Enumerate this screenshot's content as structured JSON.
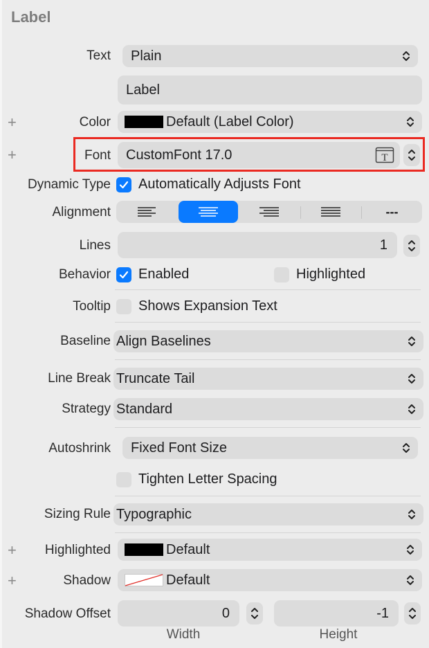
{
  "section_title": "Label",
  "text": {
    "label": "Text",
    "value": "Plain"
  },
  "label_text": {
    "value": "Label"
  },
  "color": {
    "label": "Color",
    "value": "Default (Label Color)",
    "swatch": "#000000"
  },
  "font": {
    "label": "Font",
    "value": "CustomFont 17.0",
    "highlight_color": "#ea2a22"
  },
  "dynamic_type": {
    "label": "Dynamic Type",
    "checkbox_label": "Automatically Adjusts Font",
    "checked": true
  },
  "alignment": {
    "label": "Alignment",
    "options": [
      "left",
      "center",
      "right",
      "justified",
      "natural"
    ],
    "selected": "center",
    "natural_glyph": "---"
  },
  "lines": {
    "label": "Lines",
    "value": "1"
  },
  "behavior": {
    "label": "Behavior",
    "enabled": {
      "label": "Enabled",
      "checked": true
    },
    "highlighted": {
      "label": "Highlighted",
      "checked": false
    }
  },
  "tooltip": {
    "label": "Tooltip",
    "checkbox_label": "Shows Expansion Text",
    "checked": false
  },
  "baseline": {
    "label": "Baseline",
    "value": "Align Baselines"
  },
  "line_break": {
    "label": "Line Break",
    "value": "Truncate Tail"
  },
  "strategy": {
    "label": "Strategy",
    "value": "Standard"
  },
  "autoshrink": {
    "label": "Autoshrink",
    "value": "Fixed Font Size"
  },
  "tighten": {
    "label": "Tighten Letter Spacing",
    "checked": false
  },
  "sizing_rule": {
    "label": "Sizing Rule",
    "value": "Typographic"
  },
  "highlighted_color": {
    "label": "Highlighted",
    "value": "Default",
    "swatch": "#000000"
  },
  "shadow": {
    "label": "Shadow",
    "value": "Default"
  },
  "shadow_offset": {
    "label": "Shadow Offset",
    "width": {
      "value": "0",
      "caption": "Width"
    },
    "height": {
      "value": "-1",
      "caption": "Height"
    }
  },
  "colors": {
    "accent": "#0a7aff",
    "highlight_box": "#ea2a22",
    "control_bg": "#dcdcdc",
    "panel_bg": "#ececec"
  },
  "icons": [
    "plus-icon",
    "chevron-updown-icon",
    "font-picker-icon",
    "checkmark-icon",
    "align-left-icon",
    "align-center-icon",
    "align-right-icon",
    "align-justified-icon",
    "stepper-icon"
  ]
}
